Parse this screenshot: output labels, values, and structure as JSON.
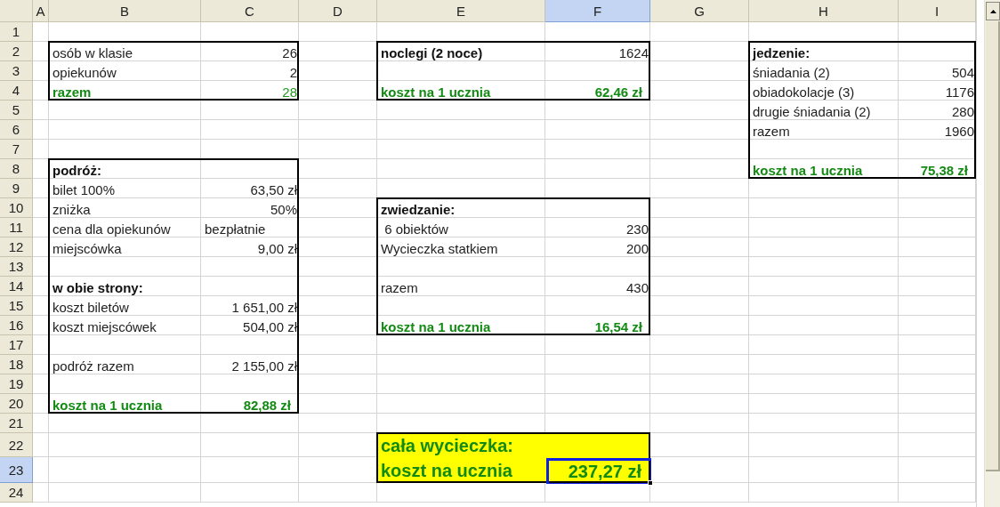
{
  "columns": [
    {
      "label": "A",
      "selected": false
    },
    {
      "label": "B",
      "selected": false
    },
    {
      "label": "C",
      "selected": false
    },
    {
      "label": "D",
      "selected": false
    },
    {
      "label": "E",
      "selected": false
    },
    {
      "label": "F",
      "selected": true
    },
    {
      "label": "G",
      "selected": false
    },
    {
      "label": "H",
      "selected": false
    },
    {
      "label": "I",
      "selected": false
    }
  ],
  "rows": [
    {
      "number": "1",
      "selected": false
    },
    {
      "number": "2",
      "selected": false
    },
    {
      "number": "3",
      "selected": false
    },
    {
      "number": "4",
      "selected": false
    },
    {
      "number": "5",
      "selected": false
    },
    {
      "number": "6",
      "selected": false
    },
    {
      "number": "7",
      "selected": false
    },
    {
      "number": "8",
      "selected": false
    },
    {
      "number": "9",
      "selected": false
    },
    {
      "number": "10",
      "selected": false
    },
    {
      "number": "11",
      "selected": false
    },
    {
      "number": "12",
      "selected": false
    },
    {
      "number": "13",
      "selected": false
    },
    {
      "number": "14",
      "selected": false
    },
    {
      "number": "15",
      "selected": false
    },
    {
      "number": "16",
      "selected": false
    },
    {
      "number": "17",
      "selected": false
    },
    {
      "number": "18",
      "selected": false
    },
    {
      "number": "19",
      "selected": false
    },
    {
      "number": "20",
      "selected": false
    },
    {
      "number": "21",
      "selected": false
    },
    {
      "number": "22",
      "selected": false
    },
    {
      "number": "23",
      "selected": true
    },
    {
      "number": "24",
      "selected": false
    }
  ],
  "blocks": [
    {
      "highlighted": false,
      "lines": [
        {
          "kind": "item",
          "label": "osób w klasie",
          "value": "26"
        },
        {
          "kind": "item",
          "label": "opiekunów",
          "value": "2"
        },
        {
          "kind": "sum",
          "label": "razem",
          "value": "28"
        }
      ]
    },
    {
      "highlighted": false,
      "lines": [
        {
          "kind": "heading",
          "label": "noclegi (2 noce)",
          "value": "1624"
        },
        {
          "kind": "spacer"
        },
        {
          "kind": "total",
          "label": "koszt na 1 ucznia",
          "value": "62,46 zł"
        }
      ]
    },
    {
      "highlighted": false,
      "lines": [
        {
          "kind": "heading",
          "label": "jedzenie:"
        },
        {
          "kind": "item",
          "label": "śniadania (2)",
          "value": "504"
        },
        {
          "kind": "item",
          "label": "obiadokolacje (3)",
          "value": "1176"
        },
        {
          "kind": "item",
          "label": "drugie śniadania (2)",
          "value": "280"
        },
        {
          "kind": "item",
          "label": "razem",
          "value": "1960"
        },
        {
          "kind": "spacer"
        },
        {
          "kind": "total",
          "label": "koszt na 1 ucznia",
          "value": "75,38 zł"
        }
      ]
    },
    {
      "highlighted": false,
      "lines": [
        {
          "kind": "heading",
          "label": "podróż:"
        },
        {
          "kind": "item",
          "label": "bilet 100%",
          "value": "63,50 zł"
        },
        {
          "kind": "item",
          "label": "zniżka",
          "value": "50%"
        },
        {
          "kind": "note",
          "label": "cena dla opiekunów",
          "value": "bezpłatnie"
        },
        {
          "kind": "item",
          "label": "miejscówka",
          "value": "9,00 zł"
        },
        {
          "kind": "spacer"
        },
        {
          "kind": "heading",
          "label": "w obie strony:"
        },
        {
          "kind": "item",
          "label": "koszt biletów",
          "value": "1 651,00 zł"
        },
        {
          "kind": "item",
          "label": "koszt miejscówek",
          "value": "504,00 zł"
        },
        {
          "kind": "spacer"
        },
        {
          "kind": "item",
          "label": "podróż razem",
          "value": "2 155,00 zł"
        },
        {
          "kind": "spacer"
        },
        {
          "kind": "total",
          "label": "koszt na 1 ucznia",
          "value": "82,88 zł"
        }
      ]
    },
    {
      "highlighted": false,
      "lines": [
        {
          "kind": "heading",
          "label": "zwiedzanie:"
        },
        {
          "kind": "item",
          "label": " 6 obiektów",
          "value": "230"
        },
        {
          "kind": "item",
          "label": "Wycieczka statkiem",
          "value": "200"
        },
        {
          "kind": "spacer"
        },
        {
          "kind": "item",
          "label": "razem",
          "value": "430"
        },
        {
          "kind": "spacer"
        },
        {
          "kind": "total",
          "label": "koszt na 1 ucznia",
          "value": "16,54 zł"
        }
      ]
    },
    {
      "highlighted": true,
      "lines": [
        {
          "kind": "grand",
          "label": "cała wycieczka:"
        },
        {
          "kind": "grand",
          "label": "koszt na ucznia",
          "value": "237,27 zł"
        }
      ]
    }
  ]
}
